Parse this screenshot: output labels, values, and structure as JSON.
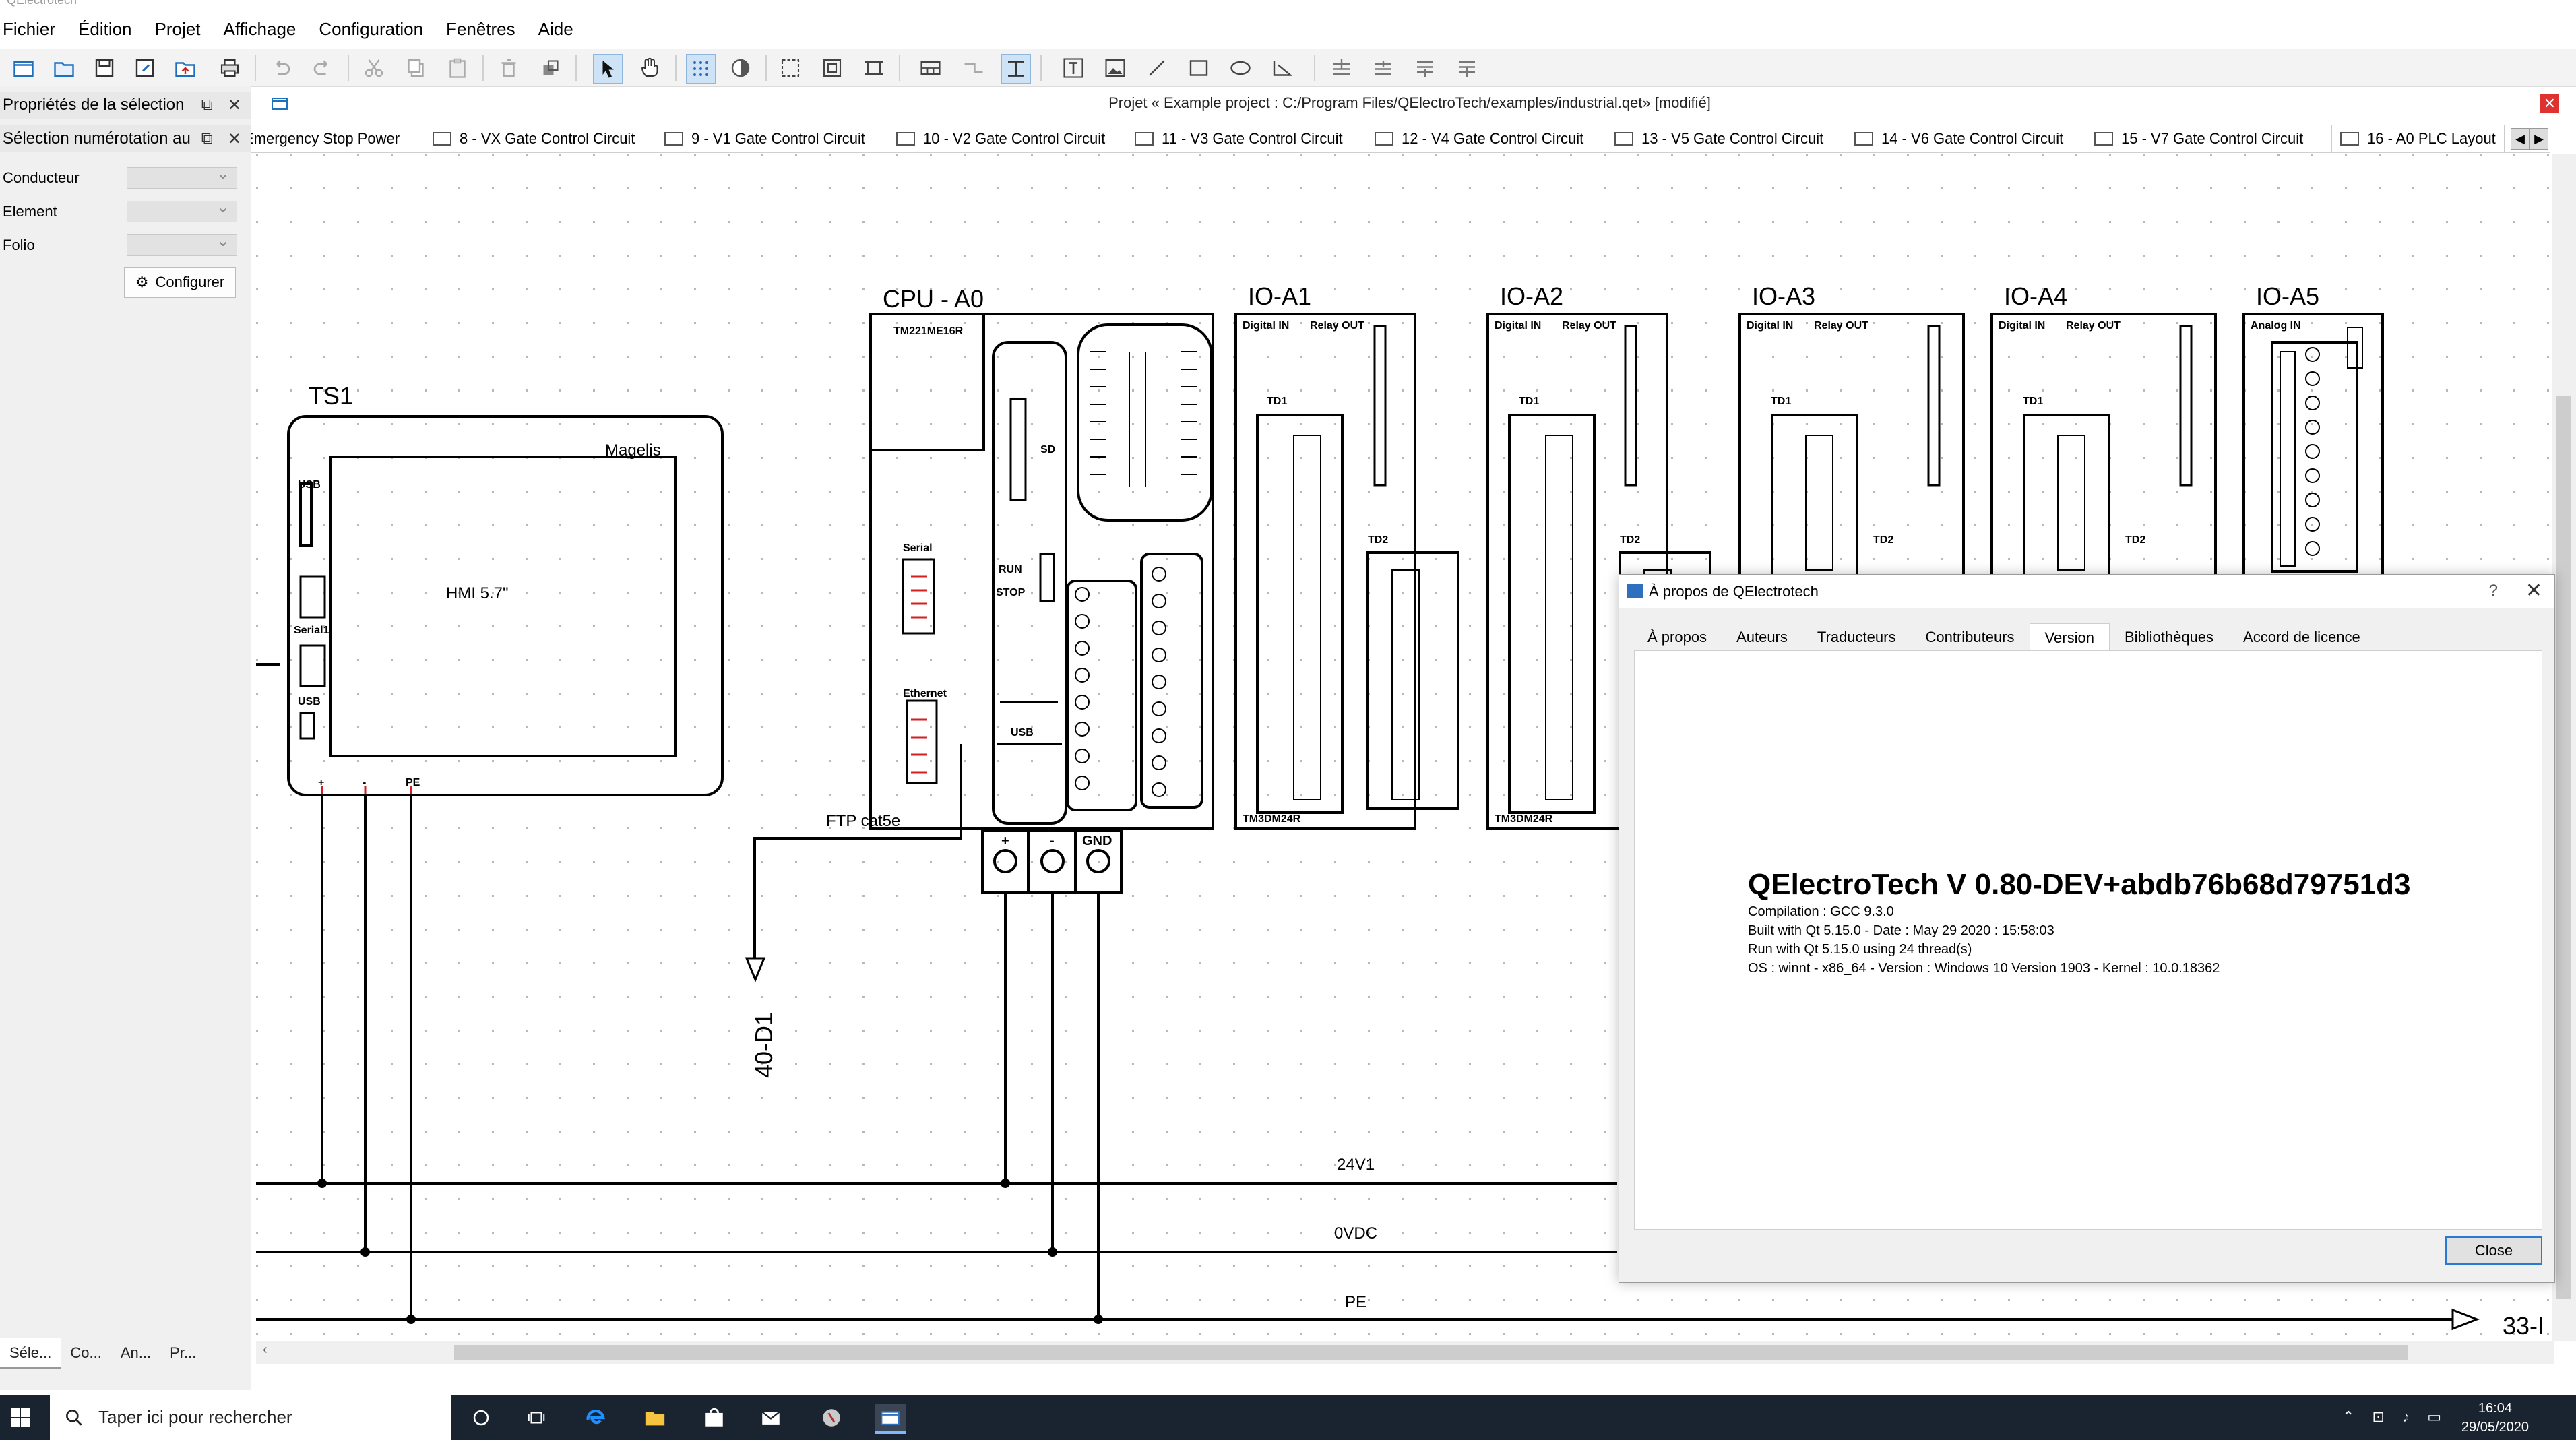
{
  "window": {
    "title": "QElectrotech"
  },
  "menu": [
    "Fichier",
    "Édition",
    "Projet",
    "Affichage",
    "Configuration",
    "Fenêtres",
    "Aide"
  ],
  "toolbar": {
    "icons": [
      "new-project-icon",
      "open-icon",
      "save-icon",
      "save-as-icon",
      "export-icon",
      "print-icon",
      "undo-icon",
      "redo-icon",
      "cut-icon",
      "copy-icon",
      "paste-icon",
      "delete-icon",
      "rotate-icon",
      "select-icon",
      "hand-icon",
      "grid-icon",
      "darkmode-icon",
      "zoom-fit-icon",
      "zoom-content-icon",
      "zoom-page-icon",
      "title-block-icon",
      "conductor-icon",
      "autoconductor-icon",
      "text-icon",
      "image-icon",
      "line-icon",
      "rectangle-icon",
      "ellipse-icon",
      "polyline-icon",
      "bring-front-icon",
      "raise-icon",
      "lower-icon",
      "send-back-icon"
    ]
  },
  "left_dock": {
    "panel1_title": "Propriétés de la sélection",
    "panel2_title": "Sélection numérotation auto",
    "fields": [
      {
        "label": "Conducteur",
        "value": ""
      },
      {
        "label": "Element",
        "value": ""
      },
      {
        "label": "Folio",
        "value": ""
      }
    ],
    "configure_button": "Configurer",
    "bottom_tabs": [
      "Séle...",
      "Co...",
      "An...",
      "Pr..."
    ]
  },
  "project": {
    "title": "Projet « Example project : C:/Program Files/QElectroTech/examples/industrial.qet» [modifié]",
    "close": "✕"
  },
  "folio_tabs": [
    "Emergency Stop Power",
    "8 - VX Gate Control Circuit",
    "9 - V1 Gate Control Circuit",
    "10 - V2 Gate Control Circuit",
    "11 - V3 Gate Control Circuit",
    "12 - V4 Gate Control Circuit",
    "13 - V5 Gate Control Circuit",
    "14 - V6 Gate Control Circuit",
    "15 - V7 Gate Control Circuit",
    "16 - A0 PLC Layout"
  ],
  "schematic": {
    "hmi": {
      "tag": "TS1",
      "brand": "Magelis",
      "screen": "HMI 5.7\"",
      "ports": [
        "USB",
        "Serial1",
        "USB"
      ]
    },
    "cpu": {
      "tag": "CPU - A0",
      "model": "TM221ME16R",
      "labels": [
        "Serial",
        "Ethernet",
        "RUN",
        "STOP",
        "SD",
        "USB"
      ]
    },
    "modules": [
      {
        "tag": "IO-A1",
        "model": "TM3DM24R"
      },
      {
        "tag": "IO-A2",
        "model": "TM3DM24R"
      },
      {
        "tag": "IO-A3",
        "model": ""
      },
      {
        "tag": "IO-A4",
        "model": ""
      },
      {
        "tag": "IO-A5",
        "model": ""
      }
    ],
    "module_labels": {
      "digital_in": "Digital IN",
      "relay_out": "Relay OUT",
      "td1": "TD1",
      "td2": "TD2",
      "analog_in": "Analog IN"
    },
    "power_terminals": [
      "+",
      "-",
      "GND"
    ],
    "hmi_terminals": [
      "+",
      "-",
      "PE"
    ],
    "cable_label": "FTP cat5e",
    "ref_down": "40-D1",
    "ref_right": "33-I",
    "rails": [
      "24V1",
      "0VDC",
      "PE"
    ]
  },
  "dialog": {
    "title": "À propos de QElectrotech",
    "help": "?",
    "close_x": "✕",
    "tabs": [
      "À propos",
      "Auteurs",
      "Traducteurs",
      "Contributeurs",
      "Version",
      "Bibliothèques",
      "Accord de licence"
    ],
    "active_tab": "Version",
    "version_title": "QElectroTech V 0.80-DEV+abdb76b68d79751d3",
    "lines": [
      "Compilation : GCC 9.3.0",
      "Built with Qt 5.15.0 - Date : May 29 2020 : 15:58:03",
      "Run with Qt 5.15.0 using 24 thread(s)",
      "OS : winnt - x86_64 - Version : Windows 10 Version 1903 - Kernel : 10.0.18362"
    ],
    "close_button": "Close"
  },
  "taskbar": {
    "search_placeholder": "Taper ici pour rechercher",
    "time": "16:04",
    "date": "29/05/2020",
    "apps": [
      "cortana-icon",
      "task-view-icon",
      "edge-icon",
      "explorer-icon",
      "store-icon",
      "mail-icon",
      "app-icon",
      "qelectrotech-icon"
    ]
  },
  "colors": {
    "accent": "#2a7ad5",
    "taskbar": "#1a2330",
    "close_red": "#e03131"
  }
}
